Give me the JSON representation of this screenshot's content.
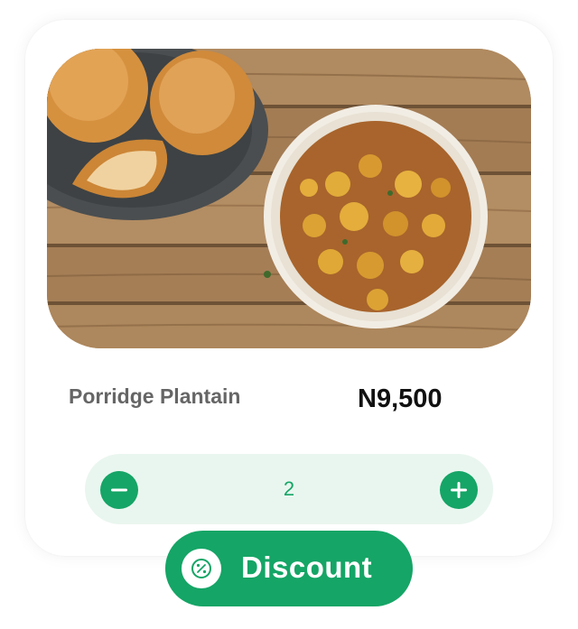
{
  "product": {
    "image_alt": "Porridge plantain in a white bowl with bread rolls on a wooden table",
    "name": "Porridge Plantain",
    "price": "N9,500"
  },
  "quantity": {
    "value": "2",
    "decrement_icon": "minus-icon",
    "increment_icon": "plus-icon"
  },
  "discount": {
    "label": "Discount",
    "icon": "percent-icon"
  },
  "colors": {
    "accent": "#15a566",
    "stepper_bg": "#e9f6ef",
    "name_text": "#666666",
    "price_text": "#111111"
  }
}
